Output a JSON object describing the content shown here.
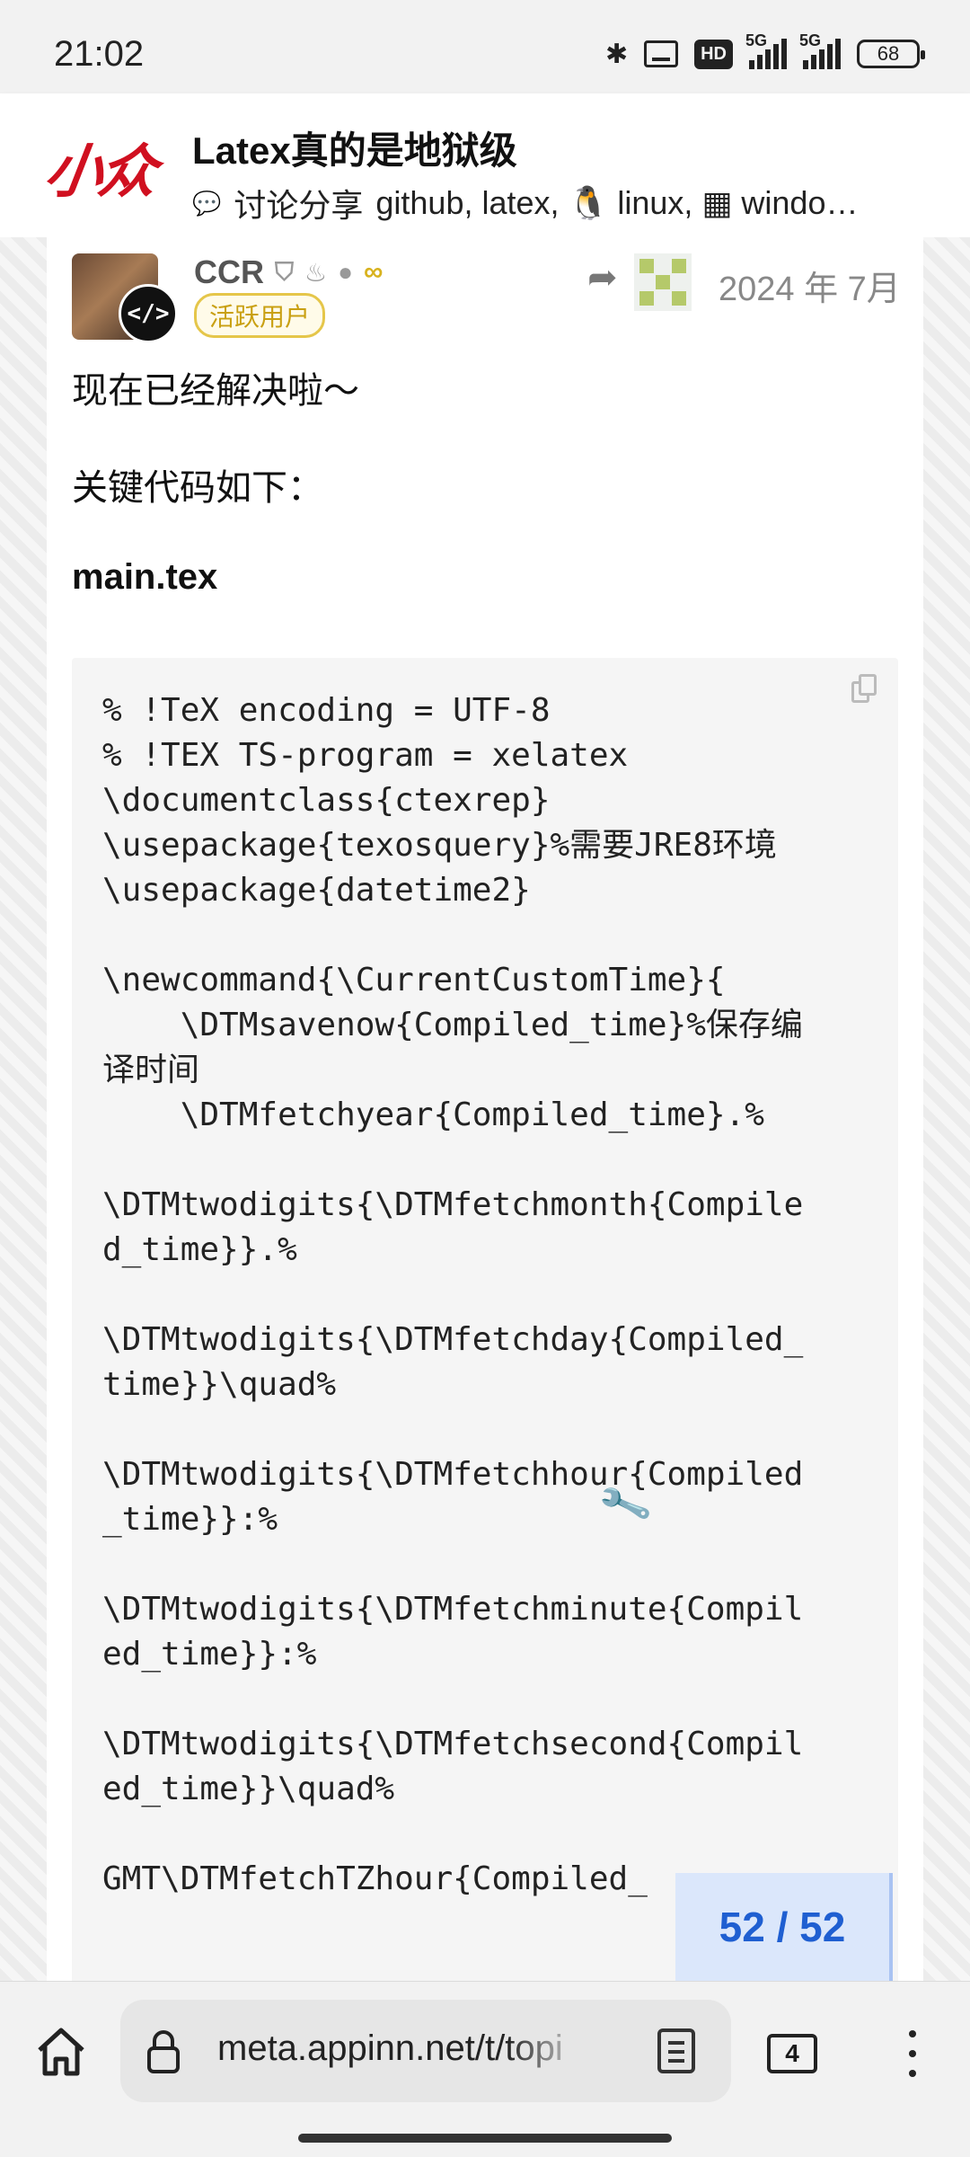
{
  "status_bar": {
    "time": "21:02",
    "network_1": "5G",
    "network_2": "5G",
    "hd_label": "HD",
    "battery": "68"
  },
  "topic": {
    "site_logo_text": "小众",
    "title": "Latex真的是地狱级",
    "category": "讨论分享",
    "tags": "github, latex, 🐧 linux, ▦ windo…"
  },
  "post": {
    "username": "CCR",
    "user_title": "活跃用户",
    "avatar_badge": "</>",
    "date": "2024 年 7月",
    "line_1": "现在已经解决啦～",
    "line_2": "关键代码如下：",
    "file_name": "main.tex",
    "code": "% !TeX encoding = UTF-8\n% !TEX TS-program = xelatex\n\\documentclass{ctexrep}\n\\usepackage{texosquery}%需要JRE8环境\n\\usepackage{datetime2}\n\n\\newcommand{\\CurrentCustomTime}{\n    \\DTMsavenow{Compiled_time}%保存编译时间\n    \\DTMfetchyear{Compiled_time}.%\n\n\\DTMtwodigits{\\DTMfetchmonth{Compiled_time}}.%\n\n\\DTMtwodigits{\\DTMfetchday{Compiled_time}}\\quad%\n\n\\DTMtwodigits{\\DTMfetchhour{Compiled_time}}:%\n\n\\DTMtwodigits{\\DTMfetchminute{Compiled_time}}:%\n\n\\DTMtwodigits{\\DTMfetchsecond{Compiled_time}}\\quad%\n\nGMT\\DTMfetchTZhour{Compiled_"
  },
  "progress": "52 / 52",
  "browser": {
    "url": "meta.appinn.net/t/topi",
    "tab_count": "4"
  },
  "icons": {
    "home": "home-icon",
    "lock": "lock-icon",
    "reader": "reader-mode-icon",
    "menu": "more-vert-icon",
    "copy": "copy-icon",
    "wrench": "wrench-icon",
    "reply": "reply-arrow-icon"
  },
  "colors": {
    "progress_bg": "#dbe7fb",
    "progress_text": "#1f5fd1",
    "user_title": "#c9a012",
    "logo_red": "#d01020"
  }
}
